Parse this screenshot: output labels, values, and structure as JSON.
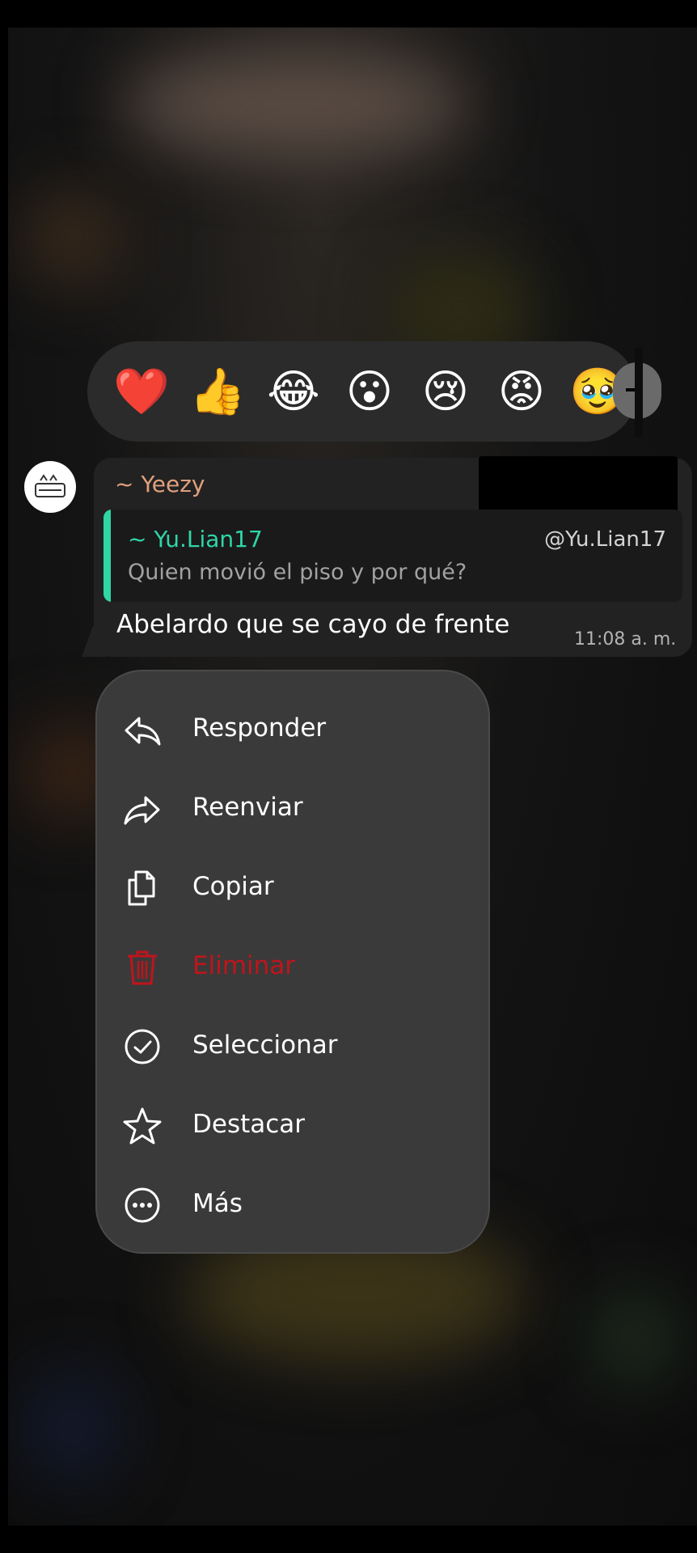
{
  "reactions": [
    {
      "emoji": "❤️",
      "name": "heart"
    },
    {
      "emoji": "👍",
      "name": "thumbs-up"
    },
    {
      "emoji": "😂",
      "name": "tears-of-joy"
    },
    {
      "emoji": "😮",
      "name": "surprised"
    },
    {
      "emoji": "😢",
      "name": "crying"
    },
    {
      "emoji": "😡",
      "name": "angry"
    },
    {
      "emoji": "🥹",
      "name": "holding-back-tears"
    }
  ],
  "message": {
    "sender": "~ Yeezy",
    "quote": {
      "author": "~ Yu.Lian17",
      "handle": "@Yu.Lian17",
      "text": "Quien movió el piso y por qué?"
    },
    "text": "Abelardo que se cayo de frente",
    "time": "11:08 a. m."
  },
  "menu": {
    "items": [
      {
        "label": "Responder",
        "icon": "reply-icon"
      },
      {
        "label": "Reenviar",
        "icon": "forward-icon"
      },
      {
        "label": "Copiar",
        "icon": "copy-icon"
      },
      {
        "label": "Eliminar",
        "icon": "trash-icon",
        "color": "#c0141c"
      },
      {
        "label": "Seleccionar",
        "icon": "check-circle-icon"
      },
      {
        "label": "Destacar",
        "icon": "star-icon"
      },
      {
        "label": "Más",
        "icon": "more-dots-icon"
      }
    ]
  },
  "colors": {
    "accent_quote": "#2fd6a6",
    "sender_name": "#e0a07e",
    "danger": "#c0141c",
    "menu_bg": "#3a3a3a",
    "bubble_bg": "#222222"
  }
}
